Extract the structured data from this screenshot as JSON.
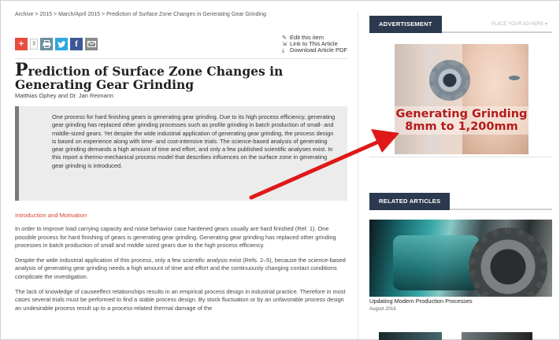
{
  "breadcrumb": [
    "Archive",
    "2015",
    "March/April 2015",
    "Prediction of Surface Zone Changes in Generating Gear Grinding"
  ],
  "breadcrumb_sep": ">",
  "share": {
    "count": "3"
  },
  "article_tools": {
    "edit": "Edit this item",
    "link": "Link to This Article",
    "download": "Download Article PDF"
  },
  "article": {
    "title_first_letter": "P",
    "title_rest": "rediction of Surface Zone Changes in Generating Gear Grinding",
    "authors": "Matthias Ophey and Dr. Jan Reimann",
    "abstract": "One process for hard finishing gears is generating gear grinding. Due to its high process efficiency, generating gear grinding has replaced other grinding processes such as profile grinding in batch production of small- and middle-sized gears. Yet despite the wide industrial application of generating gear grinding, the process design is based on experience along with time- and cost-intensive trials. The science-based analysis of generating gear grinding demands a high amount of time and effort, and only a few published scientific analyses exist. In this report a thermo-mechanical process model that describes influences on the surface zone in generating gear grinding is introduced.",
    "section_title": "Introduction and Motivation",
    "paragraphs": [
      "In order to improve load carrying capacity and noise behavior case hardened gears usually are hard finished (Ref. 1). One possible process for hard finishing of gears is generating gear grinding. Generating gear grinding has replaced other grinding processes in batch production of small and middle sized gears due to the high process efficiency.",
      "Despite the wide industrial application of this process, only a few scientific analysis exist (Refs. 2–5), because the science-based analysis of generating gear grinding needs a high amount of time and effort and the continuously changing contact conditions complicate the investigation.",
      "The lack of knowledge of causeeffect relationships results in an empirical process design in industrial practice. Therefore in most cases several trials must be performed to find a stable process design. By stock fluctuation or by an unfavorable process design an undesirable process result up to a process-related thermal damage of the"
    ]
  },
  "sidebar": {
    "ad_tab": "ADVERTISEMENT",
    "place_ad": "PLACE YOUR AD HERE ▾",
    "ad_text_line1": "Generating Grinding",
    "ad_text_line2": "8mm to 1,200mm",
    "related_tab": "RELATED ARTICLES",
    "related_title": "Updating Modern Production Processes",
    "related_date": "August 2016"
  },
  "colors": {
    "accent_red": "#d9452b",
    "tab_navy": "#2b3a4e",
    "arrow_red": "#e01818"
  }
}
